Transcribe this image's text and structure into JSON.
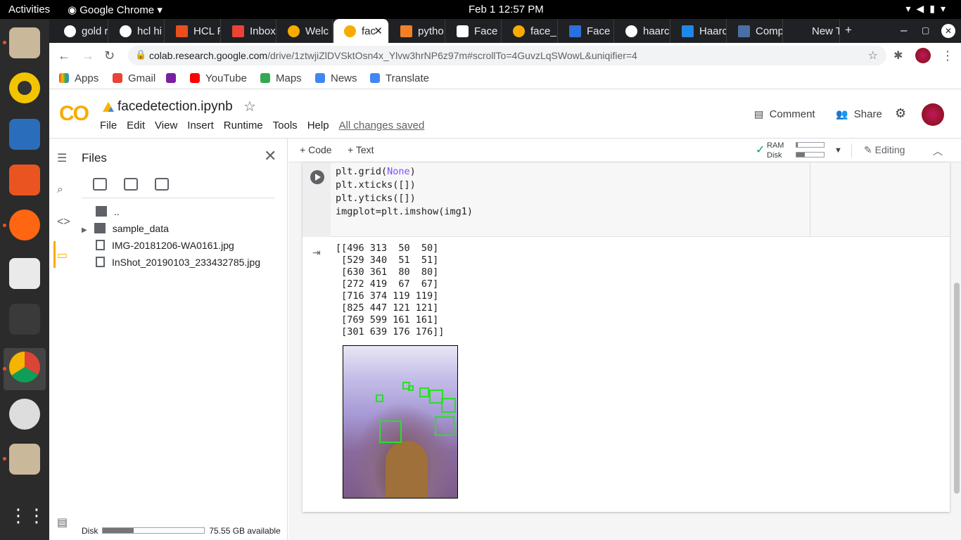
{
  "system": {
    "activities": "Activities",
    "app_name": "Google Chrome",
    "clock": "Feb 1  12:57 PM"
  },
  "tabs": [
    {
      "label": "gold r"
    },
    {
      "label": "hcl hi"
    },
    {
      "label": "HCL R"
    },
    {
      "label": "Inbox"
    },
    {
      "label": "Welc"
    },
    {
      "label": "fac"
    },
    {
      "label": "pytho"
    },
    {
      "label": "Face d"
    },
    {
      "label": "face_"
    },
    {
      "label": "Face R"
    },
    {
      "label": "haarc"
    },
    {
      "label": "Haarc"
    },
    {
      "label": "Comp"
    },
    {
      "label": "New T"
    }
  ],
  "url": {
    "host": "colab.research.google.com",
    "path": "/drive/1ztwjiZlDVSktOsn4x_Ylvw3hrNP6z97m#scrollTo=4GuvzLqSWowL&uniqifier=4"
  },
  "bookmarks": [
    {
      "label": "Apps"
    },
    {
      "label": "Gmail"
    },
    {
      "label": "YouTube"
    },
    {
      "label": "Maps"
    },
    {
      "label": "News"
    },
    {
      "label": "Translate"
    }
  ],
  "colab": {
    "logo": "CO",
    "notebook_name": "facedetection.ipynb",
    "menu": [
      "File",
      "Edit",
      "View",
      "Insert",
      "Runtime",
      "Tools",
      "Help"
    ],
    "saved_status": "All changes saved",
    "comment": "Comment",
    "share": "Share"
  },
  "sidebar": {
    "title": "Files",
    "items": [
      {
        "name": ".."
      },
      {
        "name": "sample_data"
      },
      {
        "name": "IMG-20181206-WA0161.jpg"
      },
      {
        "name": "InShot_20190103_233432785.jpg"
      }
    ],
    "disk_label": "Disk",
    "disk_available": "75.55 GB available",
    "disk_used_fraction": 0.3
  },
  "toolbar": {
    "code": "Code",
    "text": "Text",
    "ram": "RAM",
    "disk": "Disk",
    "editing": "Editing",
    "ram_fraction": 0.05,
    "disk_fraction": 0.3
  },
  "cell": {
    "code_lines": [
      "plt.grid(",
      "None",
      ")",
      "plt.xticks([])",
      "plt.yticks([])",
      "imgplot=plt.imshow(img1)"
    ],
    "output_lines": [
      "[[496 313  50  50]",
      " [529 340  51  51]",
      " [630 361  80  80]",
      " [272 419  67  67]",
      " [716 374 119 119]",
      " [825 447 121 121]",
      " [769 599 161 161]",
      " [301 639 176 176]]"
    ]
  },
  "colors": {
    "accent": "#f9ab00",
    "detection_box": "#27e027"
  }
}
